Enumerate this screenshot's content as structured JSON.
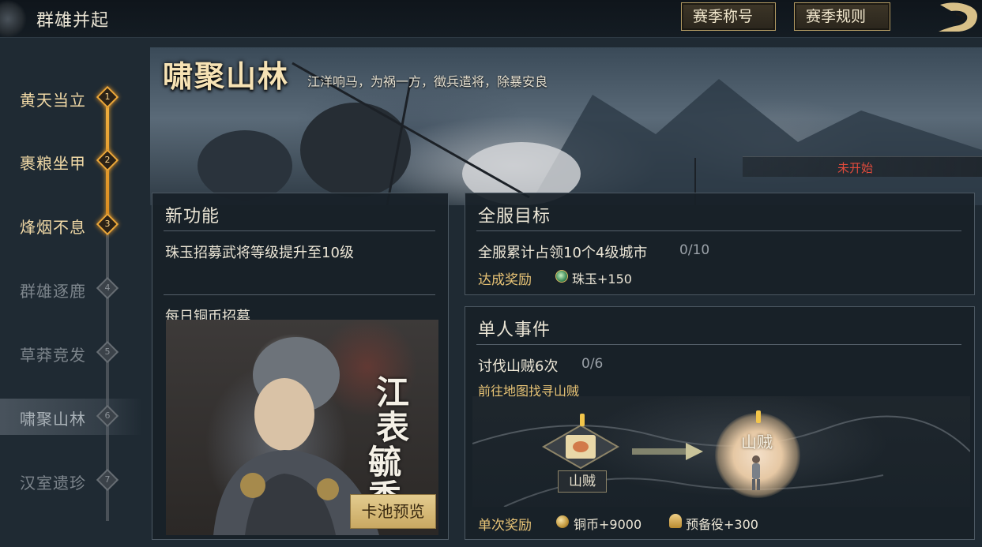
{
  "header": {
    "title": "群雄并起",
    "season_title_button": "赛季称号",
    "season_rules_button": "赛季规则"
  },
  "stage": {
    "title": "啸聚山林",
    "subtitle": "江洋响马，为祸一方，徵兵遣将，除暴安良",
    "status": "未开始"
  },
  "nav": {
    "items": [
      {
        "label": "黄天当立",
        "num": "1",
        "state": "done"
      },
      {
        "label": "裹粮坐甲",
        "num": "2",
        "state": "done"
      },
      {
        "label": "烽烟不息",
        "num": "3",
        "state": "done"
      },
      {
        "label": "群雄逐鹿",
        "num": "4",
        "state": "locked"
      },
      {
        "label": "草莽竞发",
        "num": "5",
        "state": "locked"
      },
      {
        "label": "啸聚山林",
        "num": "6",
        "state": "selected"
      },
      {
        "label": "汉室遗珍",
        "num": "7",
        "state": "locked"
      }
    ]
  },
  "new_feature": {
    "title": "新功能",
    "item1": "珠玉招募武将等级提升至10级",
    "item2": "每日铜币招募",
    "calligraphy_1": "江表",
    "calligraphy_2": "毓秀",
    "pool_preview_button": "卡池预览"
  },
  "server_goal": {
    "title": "全服目标",
    "task": "全服累计占领10个4级城市",
    "progress": "0/10",
    "reward_label": "达成奖励",
    "reward": "珠玉+150"
  },
  "personal_event": {
    "title": "单人事件",
    "task": "讨伐山贼6次",
    "progress": "0/6",
    "hint": "前往地图找寻山贼",
    "map_marker_label": "山贼",
    "target_label": "山贼",
    "reward_label": "单次奖励",
    "reward1": "铜币+9000",
    "reward2": "预备役+300"
  },
  "colors": {
    "accent_gold": "#e9c476",
    "status_red": "#e24b3c",
    "progress_orange": "#eca83a"
  },
  "icons": [
    "emblem-icon",
    "dragon-icon",
    "jade-icon",
    "copper-coin-icon",
    "reserve-icon",
    "scroll-map-icon",
    "alert-icon",
    "arrow-icon"
  ]
}
